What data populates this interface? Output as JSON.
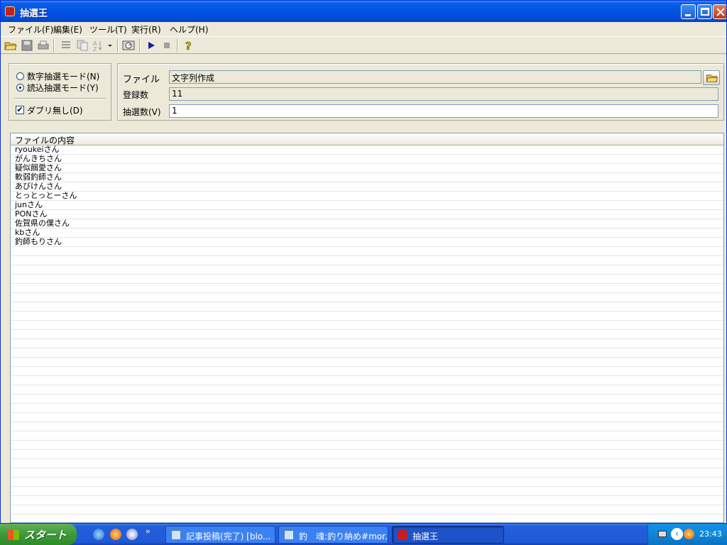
{
  "window": {
    "title": "抽選王"
  },
  "menu": [
    "ファイル(F)",
    "編集(E)",
    "ツール(T)",
    "実行(R)",
    "ヘルプ(H)"
  ],
  "modes": {
    "numeric": {
      "label": "数字抽選モード(N)",
      "selected": false
    },
    "read": {
      "label": "読込抽選モード(Y)",
      "selected": true
    },
    "no_duplicates": {
      "label": "ダブリ無し(D)",
      "checked": true
    }
  },
  "file_panel": {
    "file_label": "ファイル",
    "file_value": "文字列作成",
    "count_label": "登録数",
    "count_value": "11",
    "draw_label": "抽選数(V)",
    "draw_value": "1"
  },
  "list": {
    "header": "ファイルの内容",
    "items": [
      "ryoukeiさん",
      "がんきちさん",
      "疑似餌愛さん",
      "軟弱釣師さん",
      "あびけんさん",
      "とっとっとーさん",
      "junさん",
      "PONさん",
      "佐賀県の僕さん",
      "kbさん",
      "釣師もりさん"
    ]
  },
  "taskbar": {
    "start_label": "スタート",
    "tasks": [
      "記事投稿(完了) [blo...",
      "釣　魂:釣り納め#mor...",
      "抽選王"
    ],
    "clock": "23:43"
  },
  "colors": {
    "title_blue": "#0054e3",
    "start_green": "#3c9b36",
    "taskbar_blue": "#245edb"
  }
}
